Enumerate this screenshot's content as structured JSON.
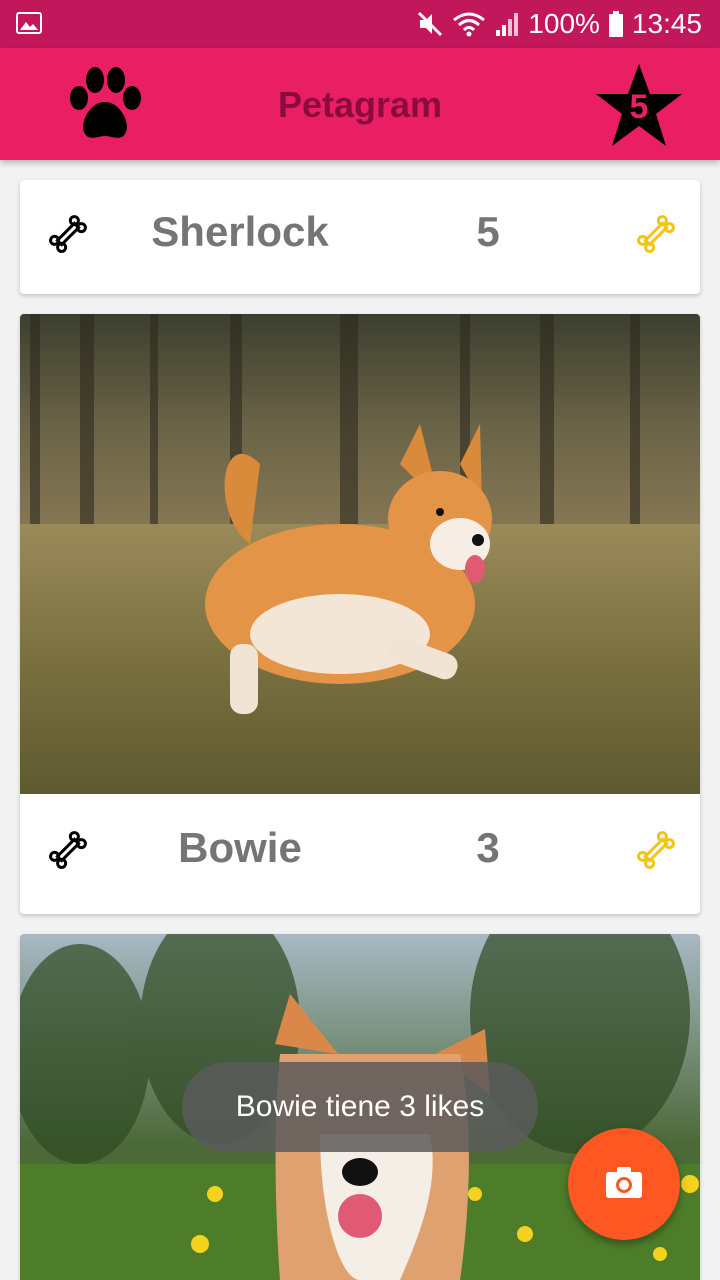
{
  "status_bar": {
    "battery_percent": "100%",
    "time": "13:45",
    "icons": [
      "gallery-icon",
      "mute-icon",
      "wifi-icon",
      "signal-icon",
      "battery-icon"
    ]
  },
  "app_bar": {
    "title": "Petagram",
    "favorites_count": "5",
    "left_icon": "paw-icon",
    "right_icon": "star-icon"
  },
  "pets": [
    {
      "name": "Sherlock",
      "likes": "5"
    },
    {
      "name": "Bowie",
      "likes": "3"
    },
    {
      "name": "",
      "likes": ""
    }
  ],
  "toast": {
    "message": "Bowie tiene 3 likes"
  },
  "fab": {
    "icon": "camera-icon"
  },
  "colors": {
    "status_bar": "#c2185b",
    "app_bar": "#e91e63",
    "title_text": "#8a0b3c",
    "like_bone": "#f0c419",
    "fab": "#ff5722"
  }
}
